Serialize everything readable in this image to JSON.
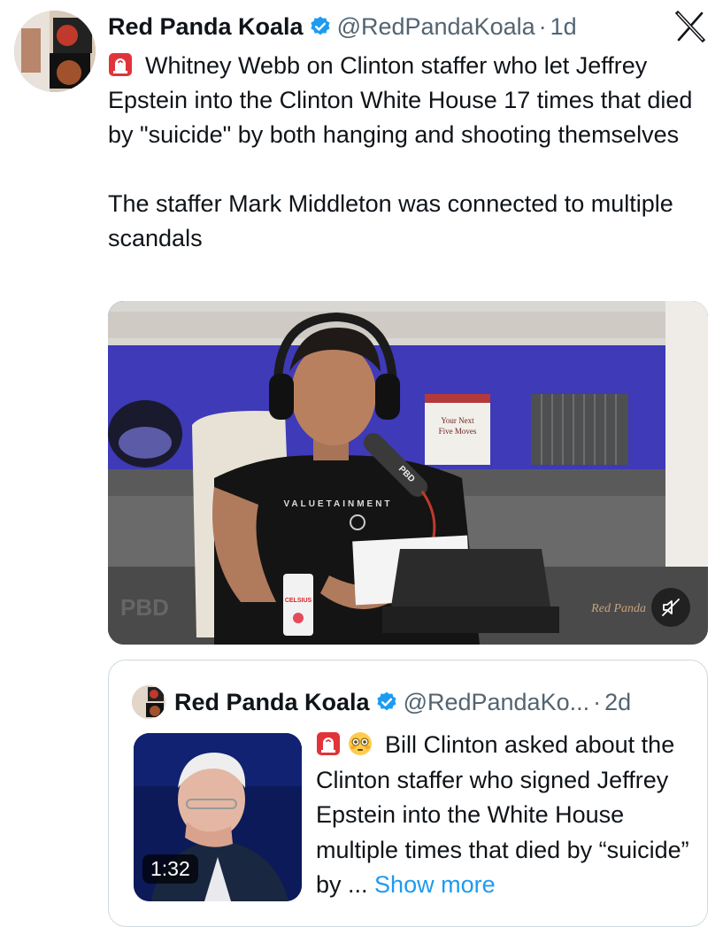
{
  "author": {
    "name": "Red Panda Koala",
    "handle": "@RedPandaKoala",
    "separator": "·",
    "time": "1d"
  },
  "icons": {
    "verified": "verified-badge-icon",
    "siren": "rotating-light-icon",
    "flushed": "flushed-face-icon",
    "platform": "x-logo-icon",
    "mute": "muted-speaker-icon"
  },
  "tweet": {
    "paragraph1": "Whitney Webb on Clinton staffer who let Jeffrey Epstein into the Clinton White House 17 times that died by \"suicide\" by both hanging and shooting themselves",
    "paragraph2": "The staffer Mark Middleton was connected to multiple scandals"
  },
  "video": {
    "book_title": "Your Next Five Moves",
    "shirt_text": "VALUETAINMENT",
    "mic_label": "PBD",
    "can_label": "CELSIUS",
    "watermark_left": "PBD",
    "watermark_right": "Red Panda"
  },
  "quote": {
    "name": "Red Panda Koala",
    "handle": "@RedPandaKo...",
    "separator": "·",
    "time": "2d",
    "text": "Bill Clinton asked about the Clinton staffer who signed Jeffrey Epstein into the White House multiple times that died by “suicide” by ...",
    "show_more": "Show more",
    "duration": "1:32"
  },
  "colors": {
    "verified": "#1d9bf0",
    "link": "#1d9bf0",
    "secondary_text": "#536471",
    "border": "#cfd9de"
  }
}
